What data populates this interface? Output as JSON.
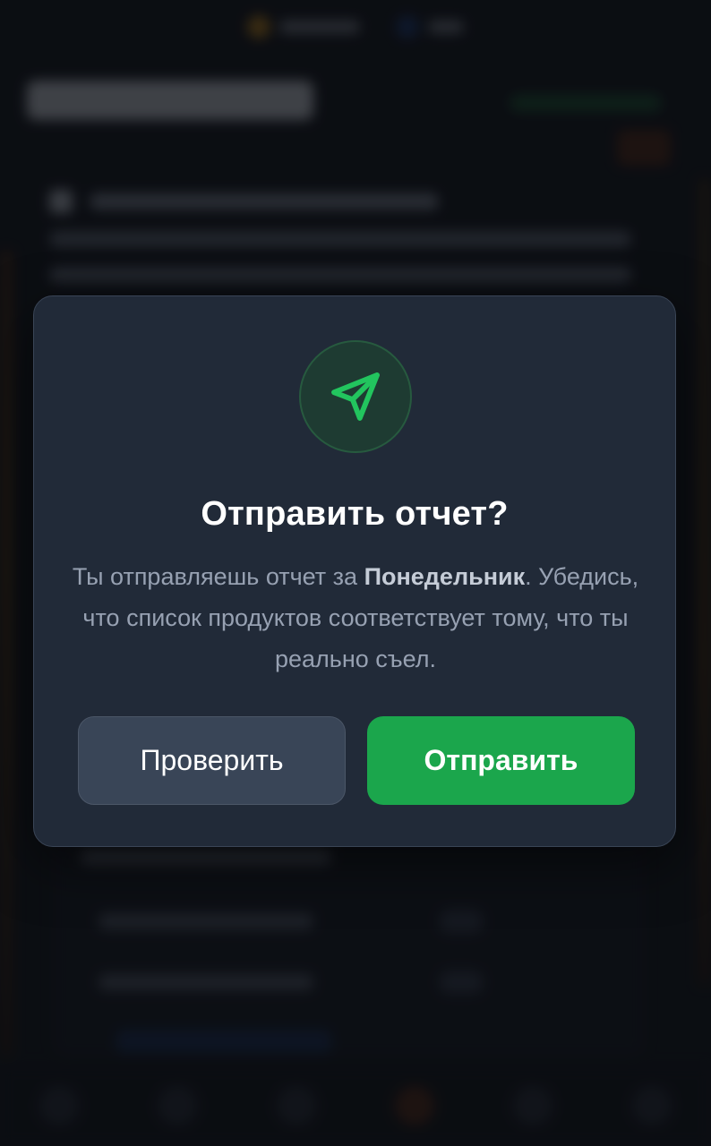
{
  "modal": {
    "title": "Отправить отчет?",
    "text_before": "Ты отправляешь отчет за ",
    "day": "Понедельник",
    "text_after": ". Убедись, что список продуктов соответствует тому, что ты реально съел.",
    "check_label": "Проверить",
    "send_label": "Отправить",
    "icon": "send-icon"
  },
  "colors": {
    "modal_bg": "#212a38",
    "accent_green": "#1ba64c",
    "icon_green": "#22c55e",
    "secondary_button": "#394557"
  }
}
